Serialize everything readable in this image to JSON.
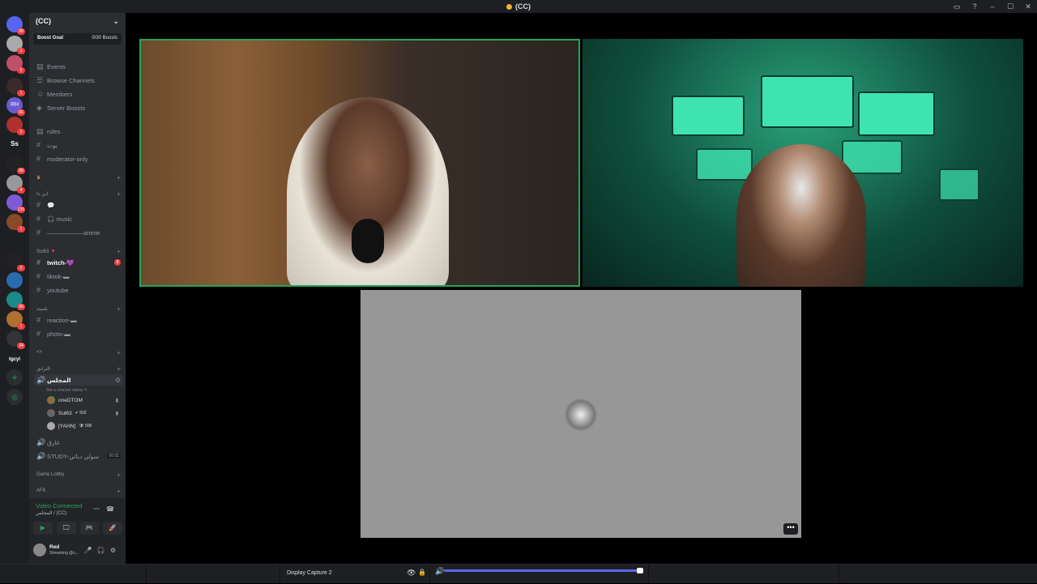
{
  "window": {
    "title": "(CC)",
    "controls": [
      "–",
      "☐",
      "✕"
    ]
  },
  "servers": [
    {
      "label": "",
      "badge": "28"
    },
    {
      "label": "",
      "badge": "1"
    },
    {
      "label": "",
      "badge": "5"
    },
    {
      "label": "",
      "badge": "1"
    },
    {
      "label": "RH",
      "badge": "66"
    },
    {
      "label": "",
      "badge": "2"
    },
    {
      "label": "Ss",
      "badge": ""
    },
    {
      "label": "",
      "badge": "99"
    },
    {
      "label": "",
      "badge": "4"
    },
    {
      "label": "",
      "badge": "136"
    },
    {
      "label": "",
      "badge": "1"
    },
    {
      "label": "",
      "badge": "2"
    },
    {
      "label": "",
      "badge": ""
    },
    {
      "label": "",
      "badge": "90"
    },
    {
      "label": "",
      "badge": "1"
    },
    {
      "label": "",
      "badge": "34"
    },
    {
      "label": "tgcyl",
      "badge": ""
    }
  ],
  "sidebar": {
    "guild_name": "(CC)",
    "boost_goal": "Boost Goal",
    "boost_count": "0/30 Boosts",
    "items": [
      {
        "label": "Events",
        "type": "nav"
      },
      {
        "label": "Browse Channels",
        "type": "nav"
      },
      {
        "label": "Members",
        "type": "nav"
      },
      {
        "label": "Server Boosts",
        "type": "nav"
      },
      {
        "label": "rules",
        "type": "text"
      },
      {
        "label": "بوت",
        "type": "text"
      },
      {
        "label": "moderator-only",
        "type": "text"
      },
      {
        "label": "",
        "type": "cat"
      },
      {
        "label": "ابي ذا",
        "type": "cat"
      },
      {
        "label": "💬",
        "type": "text"
      },
      {
        "label": "🎧 music",
        "type": "text"
      },
      {
        "label": "——————anime",
        "type": "text"
      },
      {
        "label": "Sul63 🔻",
        "type": "cat"
      },
      {
        "label": "twitch-💜",
        "type": "text"
      },
      {
        "label": "tiktok-▬",
        "type": "text"
      },
      {
        "label": "youtube",
        "type": "text"
      },
      {
        "label": "بلميته",
        "type": "cat"
      },
      {
        "label": "reaction-▬",
        "type": "text"
      },
      {
        "label": "photo-▬",
        "type": "text"
      },
      {
        "label": "<>",
        "type": "cat"
      },
      {
        "label": "الترابق",
        "type": "cat"
      },
      {
        "label": "المجلس",
        "type": "voice"
      },
      {
        "label": "Set a channel status ✎",
        "type": "status"
      },
      {
        "label": "غارق",
        "type": "voice"
      },
      {
        "label": "STUDY-سولي دياتي",
        "type": "voice"
      },
      {
        "label": "Game Lobby",
        "type": "cat"
      },
      {
        "label": "AFK",
        "type": "cat"
      }
    ],
    "twitch_badge": "3",
    "study_counts": [
      "00",
      "01"
    ],
    "voice_users": [
      {
        "name": "oneDTOM",
        "tag": ""
      },
      {
        "name": "Sul63",
        "tag": "✔ 502"
      },
      {
        "name": "[YAHN]",
        "tag": "🛡 506"
      }
    ]
  },
  "voice_panel": {
    "status": "Video Connected",
    "channel": "المجلس / (CC)",
    "user_name": "Red",
    "user_status": "Streaming @s...",
    "buttons": [
      "▶",
      "🖵",
      "🎮",
      "🚀"
    ]
  },
  "bottom_bar": {
    "source": "Display Capture 2",
    "eye": "👁",
    "lock": "🔒",
    "volume": "🔊",
    "volume_level": 0.98
  },
  "stream_menu": "•••"
}
